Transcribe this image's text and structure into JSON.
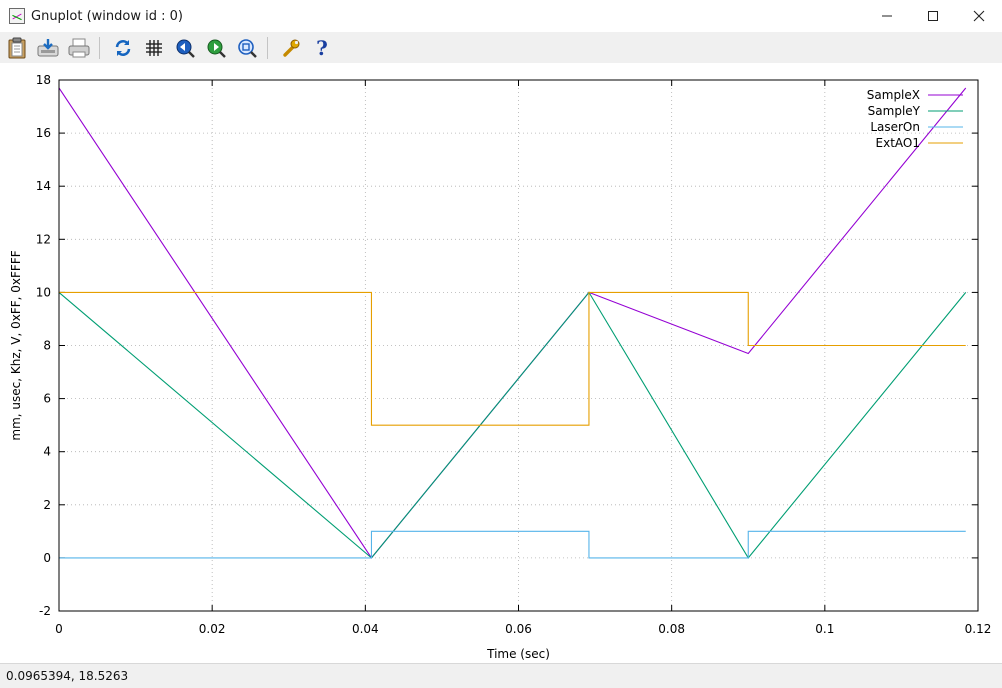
{
  "window": {
    "title": "Gnuplot (window id : 0)",
    "controls": {
      "minimize": "—",
      "maximize": "☐",
      "close": "✕"
    }
  },
  "toolbar": {
    "items": [
      {
        "name": "copy-clipboard-icon"
      },
      {
        "name": "save-icon"
      },
      {
        "name": "print-icon"
      },
      {
        "name": "replot-icon"
      },
      {
        "name": "grid-icon"
      },
      {
        "name": "zoom-previous-icon"
      },
      {
        "name": "zoom-next-icon"
      },
      {
        "name": "unzoom-icon"
      },
      {
        "name": "options-wrench-icon"
      },
      {
        "name": "help-icon"
      }
    ],
    "help_label": "?"
  },
  "status": {
    "text": "0.0965394,  18.5263"
  },
  "chart_data": {
    "type": "line",
    "title": "",
    "xlabel": "Time (sec)",
    "ylabel": "mm, usec, Khz, V, 0xFF, 0xFFFF",
    "xlim": [
      0,
      0.12
    ],
    "ylim": [
      -2,
      18
    ],
    "xticks": [
      0,
      0.02,
      0.04,
      0.06,
      0.08,
      0.1,
      0.12
    ],
    "xtick_labels": [
      "0",
      "0.02",
      "0.04",
      "0.06",
      "0.08",
      "0.1",
      "0.12"
    ],
    "yticks": [
      -2,
      0,
      2,
      4,
      6,
      8,
      10,
      12,
      14,
      16,
      18
    ],
    "ytick_labels": [
      "-2",
      "0",
      "2",
      "4",
      "6",
      "8",
      "10",
      "12",
      "14",
      "16",
      "18"
    ],
    "grid": true,
    "legend_position": "top-right",
    "series": [
      {
        "name": "SampleX",
        "color": "#9400d3",
        "points": [
          [
            0,
            17.7
          ],
          [
            0.0408,
            0
          ],
          [
            0.0692,
            10
          ],
          [
            0.09,
            7.7
          ],
          [
            0.1184,
            17.7
          ]
        ]
      },
      {
        "name": "SampleY",
        "color": "#009e73",
        "points": [
          [
            0,
            10
          ],
          [
            0.0408,
            0
          ],
          [
            0.0692,
            10
          ],
          [
            0.09,
            0
          ],
          [
            0.1184,
            10
          ]
        ]
      },
      {
        "name": "LaserOn",
        "color": "#56b4e9",
        "points": [
          [
            0,
            0
          ],
          [
            0.0408,
            0
          ],
          [
            0.0408,
            1
          ],
          [
            0.0692,
            1
          ],
          [
            0.0692,
            0
          ],
          [
            0.09,
            0
          ],
          [
            0.09,
            1
          ],
          [
            0.1184,
            1
          ]
        ]
      },
      {
        "name": "ExtAO1",
        "color": "#e69f00",
        "points": [
          [
            0,
            10
          ],
          [
            0.0408,
            10
          ],
          [
            0.0408,
            5
          ],
          [
            0.0692,
            5
          ],
          [
            0.0692,
            10
          ],
          [
            0.09,
            10
          ],
          [
            0.09,
            8
          ],
          [
            0.1184,
            8
          ]
        ]
      }
    ]
  }
}
